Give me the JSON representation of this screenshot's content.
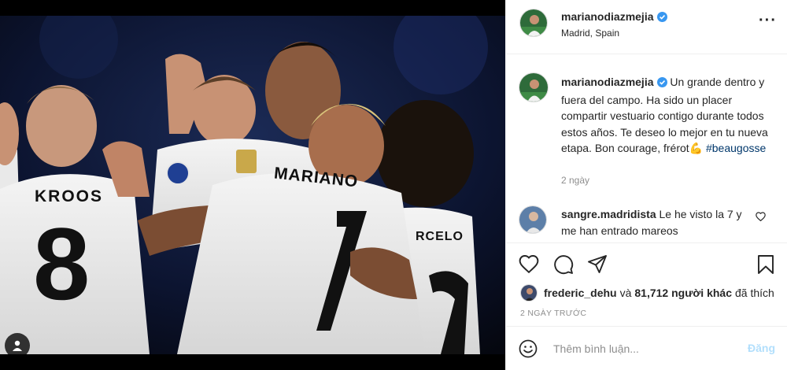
{
  "post": {
    "author": "marianodiazmejia",
    "location": "Madrid, Spain",
    "more_icon": "more-horizontal-icon",
    "verified_icon": "verified-badge-icon"
  },
  "photo": {
    "jersey_left_name": "KROOS",
    "jersey_left_number": "8",
    "jersey_center_name": "MARIANO",
    "jersey_center_number": "7",
    "jersey_right_name": "RCELO",
    "jersey_right_number": "2",
    "tag_icon": "user-tag-icon"
  },
  "caption": {
    "author": "marianodiazmejia",
    "text": "Un grande dentro y fuera del campo. Ha sido un placer compartir vestuario contigo durante todos estos años. Te deseo lo mejor en tu nueva etapa. Bon courage, frérot💪",
    "hashtag": "#beaugosse",
    "age": "2 ngày"
  },
  "comments": [
    {
      "author": "sangre.madridista",
      "text": "Le he visto la 7 y me han entrado mareos"
    }
  ],
  "actions": {
    "like_icon": "heart-icon",
    "comment_icon": "comment-icon",
    "share_icon": "paper-plane-icon",
    "save_icon": "bookmark-icon"
  },
  "likes": {
    "first_user": "frederic_dehu",
    "connector": "và",
    "others": "81,712 người khác",
    "suffix": "đã thích"
  },
  "date": "2 NGÀY TRƯỚC",
  "add_comment": {
    "placeholder": "Thêm bình luận...",
    "post_label": "Đăng",
    "emoji_icon": "emoji-icon"
  },
  "colors": {
    "link": "#00376b",
    "verified": "#3897f0",
    "post_button_disabled": "#b2dffc",
    "muted_text": "#8e8e8e"
  }
}
